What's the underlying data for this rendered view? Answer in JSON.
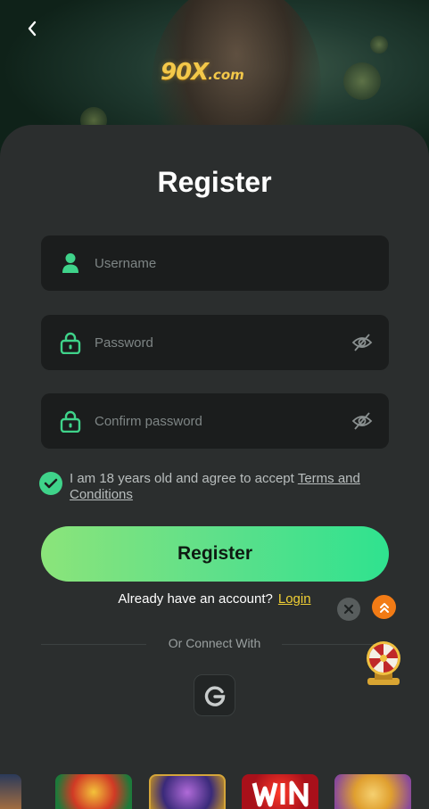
{
  "brand": {
    "logo_main": "90X",
    "logo_suffix": ".com"
  },
  "header": {
    "back_icon": "chevron-left-icon"
  },
  "form": {
    "title": "Register",
    "username": {
      "placeholder": "Username",
      "value": ""
    },
    "password": {
      "placeholder": "Password",
      "value": ""
    },
    "confirm_password": {
      "placeholder": "Confirm password",
      "value": ""
    },
    "agree_text": "I am 18 years old and agree to accept",
    "terms_link": "Terms and Conditions",
    "submit_label": "Register"
  },
  "login": {
    "prompt": "Already have an account?",
    "link": "Login"
  },
  "connect": {
    "label": "Or Connect With",
    "providers": [
      "google"
    ]
  },
  "colors": {
    "accent_green": "#3fd38a",
    "button_gradient_start": "#8be47a",
    "button_gradient_end": "#2fe28f",
    "link_yellow": "#f0cf34",
    "scroll_top_orange": "#f27b15",
    "card_bg": "#2b2e2e",
    "field_bg": "#1b1d1d"
  },
  "games": [
    "game-thumb-1",
    "game-thumb-2",
    "game-thumb-3",
    "game-thumb-win",
    "game-thumb-5"
  ]
}
